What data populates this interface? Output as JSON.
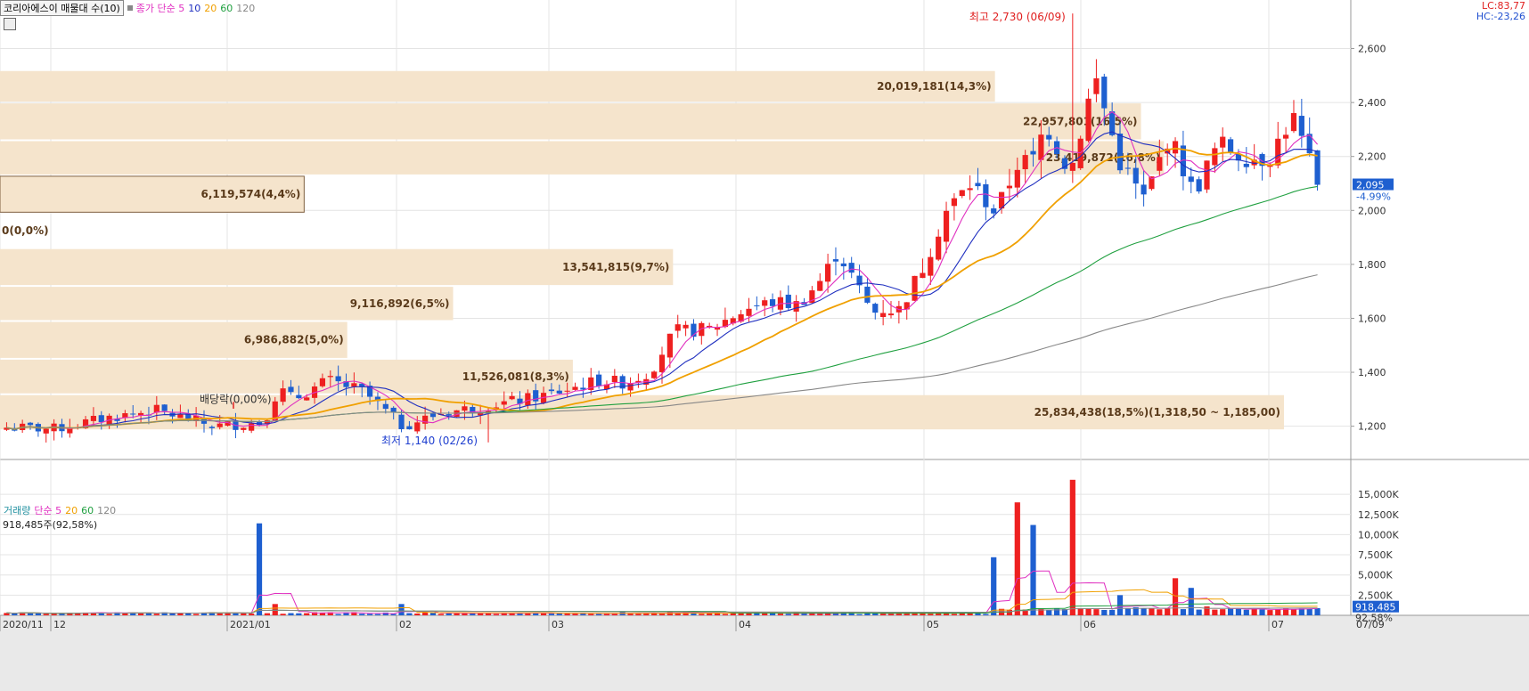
{
  "header": {
    "title": "코리아에스이 매물대 수(10)",
    "ma_label": "종가 단순 5",
    "ma_periods": [
      "10",
      "20",
      "60",
      "120"
    ]
  },
  "right_info": {
    "lc": "LC:83,77",
    "hc": "HC:-23,26"
  },
  "price_panel": {
    "yticks": [
      "2,600",
      "2,400",
      "2,200",
      "2,000",
      "1,800",
      "1,600",
      "1,400",
      "1,200"
    ],
    "current_price": "2,095",
    "current_change": "-4.99%",
    "high_annotation": "최고 2,730 (06/09)",
    "low_annotation": "최저 1,140 (02/26)",
    "dividend_annotation": "배당락(0,00%)",
    "volume_profile": [
      {
        "label": "20,019,181(14,3%)",
        "value": 20019181
      },
      {
        "label": "22,957,801(16,5%)",
        "value": 22957801
      },
      {
        "label": "23,419,872(16,8%)",
        "value": 23419872
      },
      {
        "label": "6,119,574(4,4%)",
        "value": 6119574
      },
      {
        "label": "0(0,0%)",
        "value": 0
      },
      {
        "label": "13,541,815(9,7%)",
        "value": 13541815
      },
      {
        "label": "9,116,892(6,5%)",
        "value": 9116892
      },
      {
        "label": "6,986,882(5,0%)",
        "value": 6986882
      },
      {
        "label": "11,526,081(8,3%)",
        "value": 11526081
      },
      {
        "label": "25,834,438(18,5%)(1,318,50 ~ 1,185,00)",
        "value": 25834438
      }
    ]
  },
  "volume_panel": {
    "header_label": "거래량",
    "ma_label": "단순 5",
    "ma_periods": [
      "20",
      "60",
      "120"
    ],
    "info": "918,485주(92,58%)",
    "yticks": [
      "15,000K",
      "12,500K",
      "10,000K",
      "7,500K",
      "5,000K",
      "2,500K"
    ],
    "current_volume": "918,485",
    "current_pct": "92,58%"
  },
  "xaxis": {
    "labels": [
      "2020/11",
      "12",
      "2021/01",
      "02",
      "03",
      "04",
      "05",
      "06",
      "07"
    ],
    "end_label": "07/09"
  },
  "colors": {
    "up": "#ee2020",
    "down": "#1e5fd0",
    "ma5": "#e030c0",
    "ma10": "#2030c0",
    "ma20": "#f0a000",
    "ma60": "#20a040",
    "ma120": "#888888",
    "profile": "#f5e4cc"
  },
  "chart_data": [
    {
      "type": "candlestick",
      "title": "코리아에스이 매물대 수(10)",
      "ylim": [
        1080,
        2780
      ],
      "n_bars": 167,
      "series": [
        {
          "name": "종가 단순 5",
          "kind": "moving_average"
        },
        {
          "name": "10",
          "kind": "moving_average"
        },
        {
          "name": "20",
          "kind": "moving_average"
        },
        {
          "name": "60",
          "kind": "moving_average"
        },
        {
          "name": "120",
          "kind": "moving_average"
        }
      ],
      "close_anchors": [
        [
          0,
          1195
        ],
        [
          10,
          1190
        ],
        [
          20,
          1230
        ],
        [
          30,
          1260
        ],
        [
          42,
          1200
        ],
        [
          52,
          1215
        ],
        [
          55,
          1340
        ],
        [
          58,
          1300
        ],
        [
          65,
          1370
        ],
        [
          72,
          1330
        ],
        [
          80,
          1200
        ],
        [
          88,
          1250
        ],
        [
          95,
          1270
        ],
        [
          105,
          1300
        ],
        [
          110,
          1320
        ],
        [
          120,
          1370
        ],
        [
          125,
          1360
        ],
        [
          130,
          1400
        ],
        [
          135,
          1550
        ],
        [
          142,
          1560
        ],
        [
          150,
          1640
        ],
        [
          155,
          1660
        ],
        [
          160,
          1650
        ],
        [
          165,
          1750
        ],
        [
          168,
          1850
        ],
        [
          175,
          1620
        ],
        [
          178,
          1640
        ],
        [
          180,
          1620
        ],
        [
          185,
          1780
        ],
        [
          190,
          2000
        ],
        [
          195,
          2100
        ],
        [
          200,
          1990
        ],
        [
          205,
          2200
        ],
        [
          207,
          2160
        ],
        [
          210,
          2320
        ],
        [
          215,
          2140
        ],
        [
          220,
          2500
        ],
        [
          225,
          2180
        ],
        [
          230,
          2040
        ],
        [
          235,
          2280
        ],
        [
          240,
          2060
        ],
        [
          245,
          2250
        ],
        [
          250,
          2200
        ],
        [
          255,
          2190
        ],
        [
          260,
          2350
        ],
        [
          265,
          2095
        ]
      ],
      "high": {
        "value": 2730,
        "date": "06/09"
      },
      "low": {
        "value": 1140,
        "date": "02/26"
      },
      "last_close": 2095,
      "change_pct": -4.99,
      "volume_profile_bins": [
        {
          "low": 2400,
          "high": 2520,
          "volume": 20019181,
          "pct": 14.3
        },
        {
          "low": 2260,
          "high": 2400,
          "volume": 22957801,
          "pct": 16.5
        },
        {
          "low": 2130,
          "high": 2260,
          "volume": 23419872,
          "pct": 16.8
        },
        {
          "low": 1990,
          "high": 2130,
          "volume": 6119574,
          "pct": 4.4
        },
        {
          "low": 1860,
          "high": 1990,
          "volume": 0,
          "pct": 0.0
        },
        {
          "low": 1720,
          "high": 1860,
          "volume": 13541815,
          "pct": 9.7
        },
        {
          "low": 1590,
          "high": 1720,
          "volume": 9116892,
          "pct": 6.5
        },
        {
          "low": 1450,
          "high": 1590,
          "volume": 6986882,
          "pct": 5.0
        },
        {
          "low": 1318.5,
          "high": 1450,
          "volume": 11526081,
          "pct": 8.3
        },
        {
          "low": 1185,
          "high": 1318.5,
          "volume": 25834438,
          "pct": 18.5
        }
      ],
      "xticks": [
        "2020/11",
        "12",
        "2021/01",
        "02",
        "03",
        "04",
        "05",
        "06",
        "07"
      ]
    },
    {
      "type": "bar",
      "title": "거래량",
      "ylim": [
        0,
        17000
      ],
      "unit": "K",
      "series": [
        {
          "name": "단순 5"
        },
        {
          "name": "20"
        },
        {
          "name": "60"
        },
        {
          "name": "120"
        }
      ],
      "spikes": [
        [
          51,
          11400
        ],
        [
          54,
          1400
        ],
        [
          80,
          1400
        ],
        [
          183,
          400
        ],
        [
          200,
          7200
        ],
        [
          205,
          14000
        ],
        [
          207,
          11200
        ],
        [
          215,
          16800
        ],
        [
          225,
          2500
        ],
        [
          229,
          1000
        ],
        [
          237,
          4600
        ],
        [
          240,
          3400
        ],
        [
          242,
          1100
        ]
      ],
      "base_volume": 150,
      "last_volume": 918485,
      "last_pct": 92.58
    }
  ]
}
